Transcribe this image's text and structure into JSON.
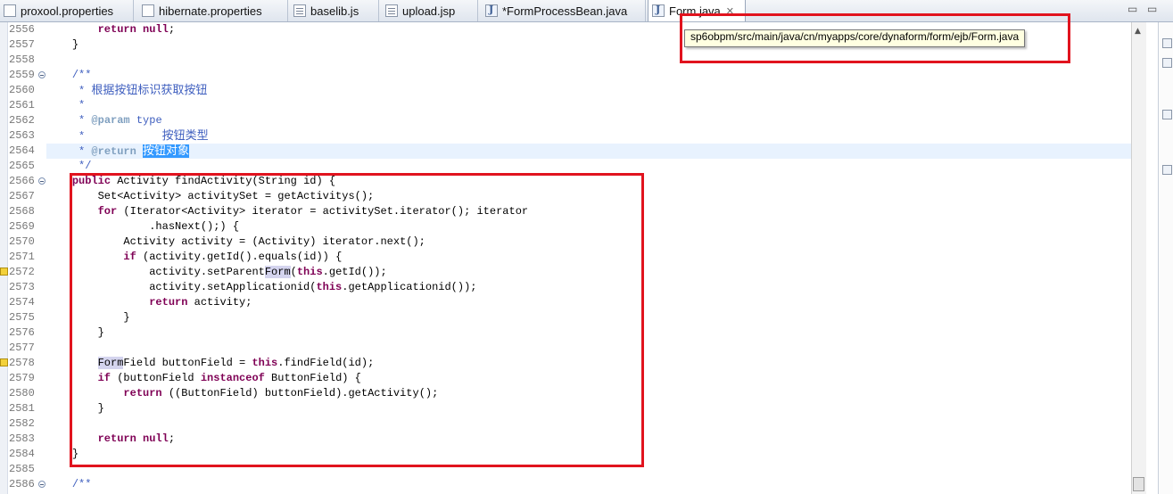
{
  "tabs": [
    {
      "label": "proxool.properties",
      "icon": "properties-file-icon",
      "active": false
    },
    {
      "label": "hibernate.properties",
      "icon": "properties-file-icon",
      "active": false
    },
    {
      "label": "baselib.js",
      "icon": "js-file-icon",
      "active": false
    },
    {
      "label": "upload.jsp",
      "icon": "jsp-file-icon",
      "active": false
    },
    {
      "label": "*FormProcessBean.java",
      "icon": "java-file-icon",
      "active": false
    },
    {
      "label": "Form.java",
      "icon": "java-file-icon",
      "active": true,
      "close": "✕"
    }
  ],
  "window_controls": {
    "minimize": "▭",
    "maximize": "▭"
  },
  "tooltip": {
    "text": "sp6obpm/src/main/java/cn/myapps/core/dynaform/form/ejb/Form.java"
  },
  "colors": {
    "keyword": "#7f0055",
    "comment": "#3f5fbf",
    "javadoc_tag": "#7f9fbf",
    "selection": "#3399ff",
    "annotation_box": "#e1131e"
  },
  "editor": {
    "lines": [
      {
        "num": "2556",
        "indent": "        ",
        "tokens": [
          {
            "t": "return null;",
            "c": "kwline"
          }
        ]
      },
      {
        "num": "2557",
        "indent": "    ",
        "tokens": [
          {
            "t": "}",
            "c": ""
          }
        ]
      },
      {
        "num": "2558",
        "indent": "",
        "tokens": []
      },
      {
        "num": "2559",
        "indent": "    ",
        "tokens": [
          {
            "t": "/**",
            "c": "cm"
          }
        ],
        "fold": true
      },
      {
        "num": "2560",
        "indent": "     ",
        "tokens": [
          {
            "t": "* ",
            "c": "cm"
          },
          {
            "t": "根据按钮标识获取按钮",
            "c": "cm cjk"
          }
        ]
      },
      {
        "num": "2561",
        "indent": "     ",
        "tokens": [
          {
            "t": "*",
            "c": "cm"
          }
        ]
      },
      {
        "num": "2562",
        "indent": "     ",
        "tokens": [
          {
            "t": "* ",
            "c": "cm"
          },
          {
            "t": "@param",
            "c": "tag"
          },
          {
            "t": " type",
            "c": "cm"
          }
        ]
      },
      {
        "num": "2563",
        "indent": "     ",
        "tokens": [
          {
            "t": "*            ",
            "c": "cm"
          },
          {
            "t": "按钮类型",
            "c": "cm cjk"
          }
        ]
      },
      {
        "num": "2564",
        "indent": "     ",
        "tokens": [
          {
            "t": "* ",
            "c": "cm"
          },
          {
            "t": "@return",
            "c": "tag"
          },
          {
            "t": " ",
            "c": "cm"
          },
          {
            "t": "按钮对象",
            "c": "sel cjk"
          }
        ],
        "highlight": true
      },
      {
        "num": "2565",
        "indent": "     ",
        "tokens": [
          {
            "t": "*/",
            "c": "cm"
          }
        ]
      },
      {
        "num": "2566",
        "indent": "    ",
        "tokens": [
          {
            "t": "public",
            "c": "kw"
          },
          {
            "t": " Activity findActivity(String id) {",
            "c": ""
          }
        ],
        "fold": true
      },
      {
        "num": "2567",
        "indent": "        ",
        "tokens": [
          {
            "t": "Set<Activity> activitySet = getActivitys();",
            "c": ""
          }
        ]
      },
      {
        "num": "2568",
        "indent": "        ",
        "tokens": [
          {
            "t": "for",
            "c": "kw"
          },
          {
            "t": " (Iterator<Activity> iterator = activitySet.iterator(); iterator",
            "c": ""
          }
        ]
      },
      {
        "num": "2569",
        "indent": "                ",
        "tokens": [
          {
            "t": ".hasNext();) {",
            "c": ""
          }
        ]
      },
      {
        "num": "2570",
        "indent": "            ",
        "tokens": [
          {
            "t": "Activity activity = (Activity) iterator.next();",
            "c": ""
          }
        ]
      },
      {
        "num": "2571",
        "indent": "            ",
        "tokens": [
          {
            "t": "if",
            "c": "kw"
          },
          {
            "t": " (activity.getId().equals(id)) {",
            "c": ""
          }
        ]
      },
      {
        "num": "2572",
        "indent": "                ",
        "tokens": [
          {
            "t": "activity.setParent",
            "c": ""
          },
          {
            "t": "Form",
            "c": "occ"
          },
          {
            "t": "(",
            "c": ""
          },
          {
            "t": "this",
            "c": "kw"
          },
          {
            "t": ".getId());",
            "c": ""
          }
        ],
        "marker": true
      },
      {
        "num": "2573",
        "indent": "                ",
        "tokens": [
          {
            "t": "activity.setApplicationid(",
            "c": ""
          },
          {
            "t": "this",
            "c": "kw"
          },
          {
            "t": ".getApplicationid());",
            "c": ""
          }
        ]
      },
      {
        "num": "2574",
        "indent": "                ",
        "tokens": [
          {
            "t": "return",
            "c": "kw"
          },
          {
            "t": " activity;",
            "c": ""
          }
        ]
      },
      {
        "num": "2575",
        "indent": "            ",
        "tokens": [
          {
            "t": "}",
            "c": ""
          }
        ]
      },
      {
        "num": "2576",
        "indent": "        ",
        "tokens": [
          {
            "t": "}",
            "c": ""
          }
        ]
      },
      {
        "num": "2577",
        "indent": "",
        "tokens": []
      },
      {
        "num": "2578",
        "indent": "        ",
        "tokens": [
          {
            "t": "Form",
            "c": "occ"
          },
          {
            "t": "Field buttonField = ",
            "c": ""
          },
          {
            "t": "this",
            "c": "kw"
          },
          {
            "t": ".findField(id);",
            "c": ""
          }
        ],
        "marker": true
      },
      {
        "num": "2579",
        "indent": "        ",
        "tokens": [
          {
            "t": "if",
            "c": "kw"
          },
          {
            "t": " (buttonField ",
            "c": ""
          },
          {
            "t": "instanceof",
            "c": "kw"
          },
          {
            "t": " ButtonField) {",
            "c": ""
          }
        ]
      },
      {
        "num": "2580",
        "indent": "            ",
        "tokens": [
          {
            "t": "return",
            "c": "kw"
          },
          {
            "t": " ((ButtonField) buttonField).getActivity();",
            "c": ""
          }
        ]
      },
      {
        "num": "2581",
        "indent": "        ",
        "tokens": [
          {
            "t": "}",
            "c": ""
          }
        ]
      },
      {
        "num": "2582",
        "indent": "",
        "tokens": []
      },
      {
        "num": "2583",
        "indent": "        ",
        "tokens": [
          {
            "t": "return",
            "c": "kw"
          },
          {
            "t": " ",
            "c": ""
          },
          {
            "t": "null",
            "c": "kw"
          },
          {
            "t": ";",
            "c": ""
          }
        ]
      },
      {
        "num": "2584",
        "indent": "    ",
        "tokens": [
          {
            "t": "}",
            "c": ""
          }
        ]
      },
      {
        "num": "2585",
        "indent": "",
        "tokens": []
      },
      {
        "num": "2586",
        "indent": "    ",
        "tokens": [
          {
            "t": "/**",
            "c": "cm"
          }
        ],
        "fold": true
      }
    ]
  }
}
